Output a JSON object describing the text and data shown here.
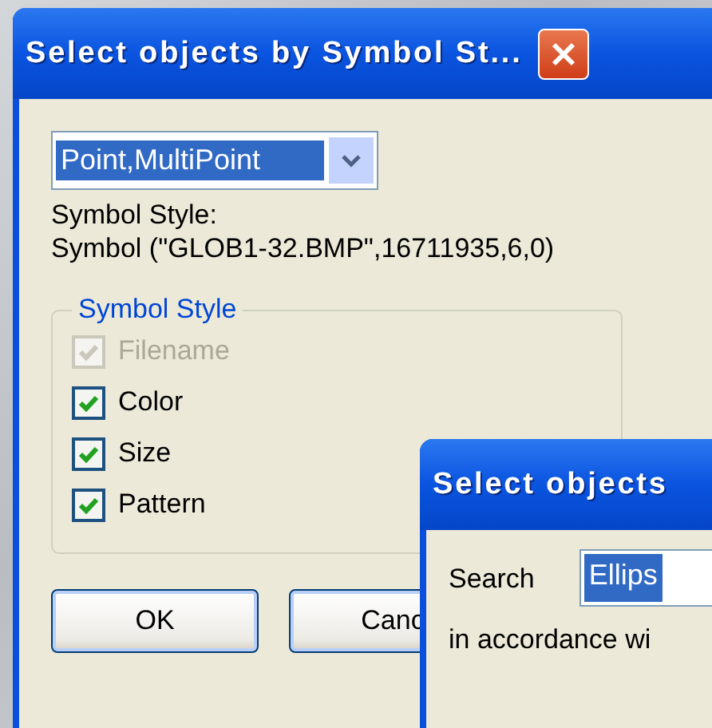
{
  "main_dialog": {
    "title": "Select objects by Symbol St...",
    "geometry_dropdown": {
      "value": "Point,MultiPoint"
    },
    "symbol_style_label": "Symbol Style:",
    "symbol_style_value": "Symbol (\"GLOB1-32.BMP\",16711935,6,0)",
    "group": {
      "title": "Symbol Style",
      "options": [
        {
          "label": "Filename",
          "checked": true,
          "disabled": true
        },
        {
          "label": "Color",
          "checked": true,
          "disabled": false
        },
        {
          "label": "Size",
          "checked": true,
          "disabled": false
        },
        {
          "label": "Pattern",
          "checked": true,
          "disabled": false
        }
      ]
    },
    "buttons": [
      "OK",
      "Canc"
    ]
  },
  "second_dialog": {
    "title": "Select objects",
    "search_label": "Search",
    "search_value": "Ellips",
    "text": "in accordance wi"
  }
}
